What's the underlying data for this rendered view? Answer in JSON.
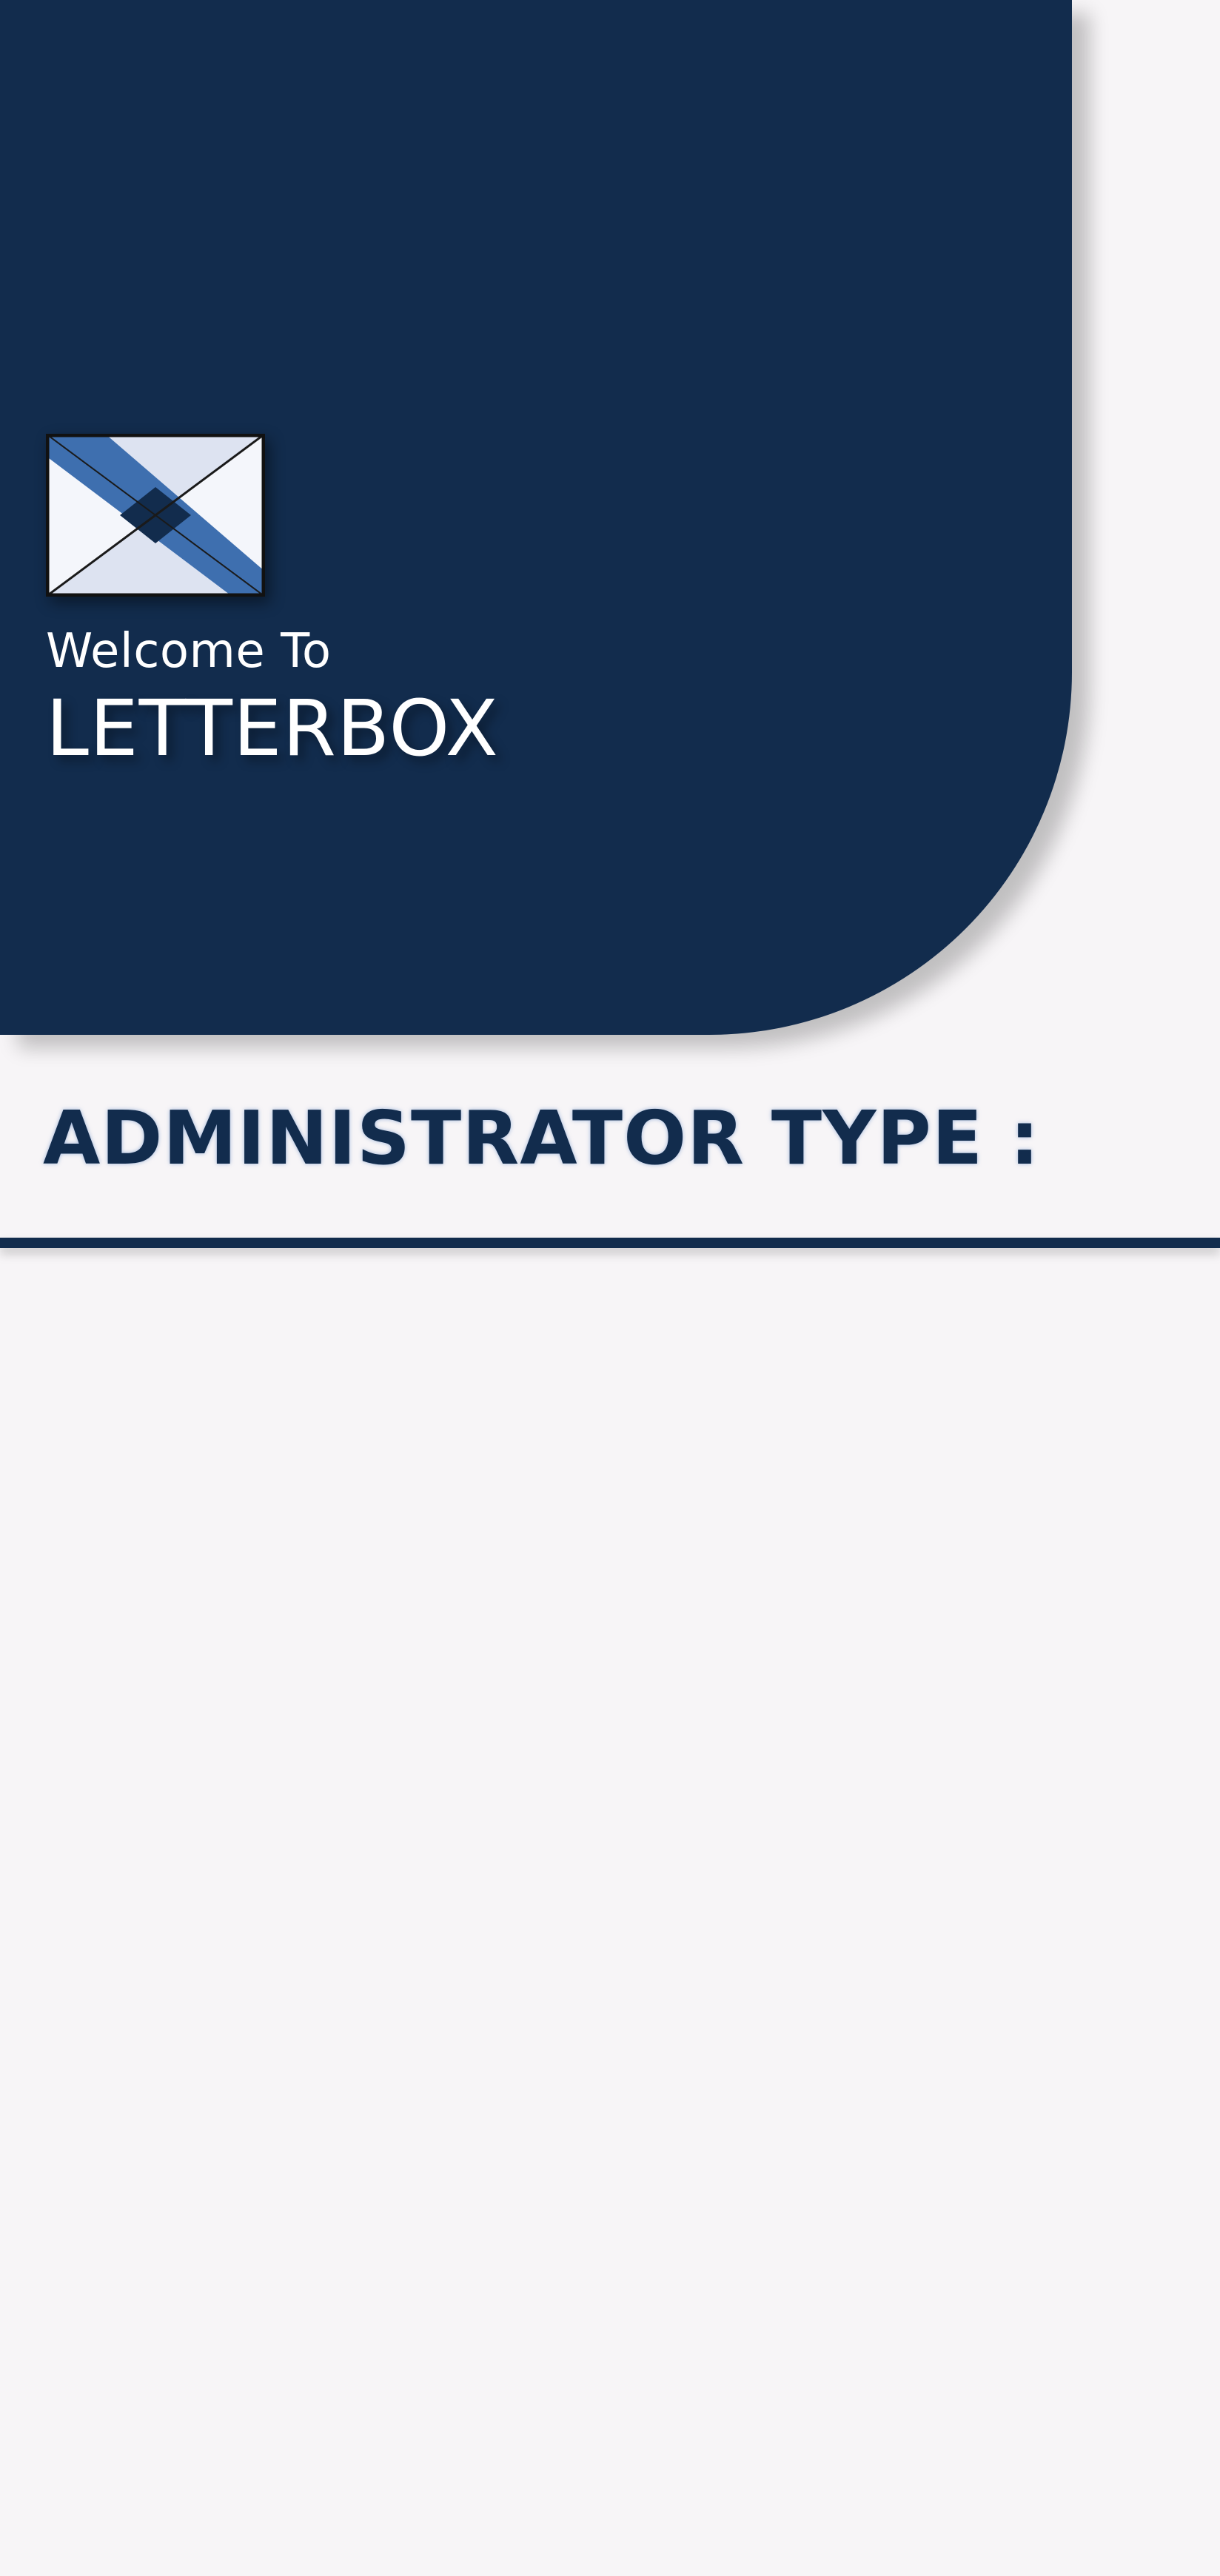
{
  "header": {
    "logo": "letterbox-envelope-logo",
    "welcome_text": "Welcome To",
    "app_name": "LETTERBOX"
  },
  "section": {
    "title": "ADMINISTRATOR TYPE :"
  },
  "colors": {
    "primary": "#122c4d",
    "background": "#f7f5f7",
    "logo_blue": "#3e6faf",
    "logo_light": "#dde3f1"
  }
}
